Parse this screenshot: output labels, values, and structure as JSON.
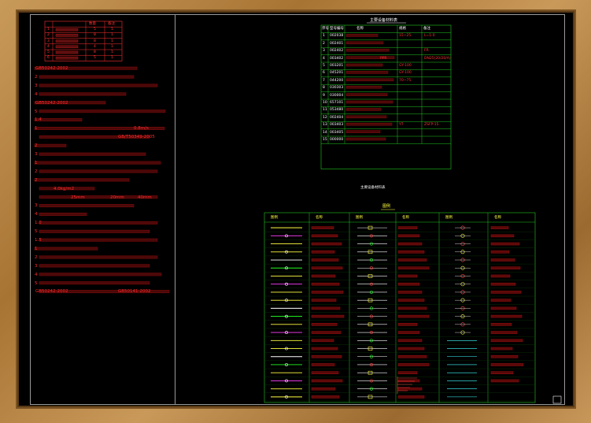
{
  "colors": {
    "frame": "#b5833f",
    "background": "#000000",
    "notes": "#ff2a2a",
    "table_border_left": "#ff3030",
    "table_border_right": "#20c820"
  },
  "notes_table": {
    "header": [
      "",
      "",
      "数量",
      "备注"
    ],
    "rows": [
      [
        "1",
        "",
        "5",
        "1"
      ],
      [
        "2",
        "",
        "8",
        "1"
      ],
      [
        "3",
        "",
        "8",
        "1"
      ],
      [
        "4",
        "",
        "4",
        "1"
      ],
      [
        "5",
        "",
        "8",
        "1"
      ],
      [
        "6",
        "",
        "5",
        "1"
      ]
    ]
  },
  "notes": [
    {
      "text": "GB50242-2002",
      "mixed": "说明：给排水管道安装符合国家规范",
      "row": 1
    },
    {
      "text": "2",
      "row": 2
    },
    {
      "text": "3",
      "row": 3
    },
    {
      "text": "4",
      "row": 4
    },
    {
      "text": "GB50242-2002",
      "row": 5
    },
    {
      "text": "5",
      "row": 6
    },
    {
      "text": "1.4",
      "row": 7
    },
    {
      "text": "1",
      "row": 8
    },
    {
      "text": "0.8m/s",
      "row": 8
    },
    {
      "text": "GB/T50349-2005",
      "row": 9
    },
    {
      "text": "2",
      "row": 10
    },
    {
      "text": "3",
      "row": 11
    },
    {
      "text": "1",
      "row": 12
    },
    {
      "text": "2",
      "row": 13
    },
    {
      "text": "2",
      "row": 14
    },
    {
      "text": "4.0kg/m2",
      "row": 15
    },
    {
      "text": "25mm",
      "row": 16
    },
    {
      "text": "20mm",
      "row": 16
    },
    {
      "text": "40mm",
      "row": 16
    },
    {
      "text": "3",
      "row": 17
    },
    {
      "text": "4",
      "row": 18
    },
    {
      "text": "1.0",
      "row": 19
    },
    {
      "text": "5",
      "row": 20
    },
    {
      "text": "1.5",
      "row": 21
    },
    {
      "text": "1",
      "row": 22
    },
    {
      "text": "2",
      "row": 23
    },
    {
      "text": "3",
      "row": 24
    },
    {
      "text": "4",
      "row": 25
    },
    {
      "text": "5",
      "row": 26
    },
    {
      "text": "GB50242-2002",
      "row": 27
    },
    {
      "text": "GB50141-2002",
      "row": 27
    }
  ],
  "materials_table": {
    "title": "主要设备材料表",
    "header": [
      "序号",
      "型号编号",
      "名称",
      "规格",
      "备注"
    ],
    "rows": [
      [
        "1",
        "002038",
        "",
        "15~25",
        "L=1.0"
      ],
      [
        "2",
        "002401",
        "",
        "",
        ""
      ],
      [
        "3",
        "002402",
        "",
        "",
        "FR"
      ],
      [
        "4",
        "003402",
        "PPR",
        "",
        "DN25(20/20/A)"
      ],
      [
        "5",
        "003201",
        "",
        "GY-100",
        ""
      ],
      [
        "6",
        "045201",
        "",
        "GY-100",
        ""
      ],
      [
        "7",
        "044200",
        "",
        "70~75",
        ""
      ],
      [
        "8",
        "030303",
        "",
        "",
        ""
      ],
      [
        "9",
        "030004",
        "",
        "",
        ""
      ],
      [
        "10",
        "657101",
        "",
        "",
        ""
      ],
      [
        "11",
        "053480",
        "",
        "",
        ""
      ],
      [
        "12",
        "002404",
        "",
        "",
        ""
      ],
      [
        "13",
        "003403",
        "",
        "Y7",
        "ZSFP-15"
      ],
      [
        "14",
        "003405",
        "",
        "",
        ""
      ],
      [
        "15",
        "000000",
        "",
        "",
        ""
      ]
    ],
    "footer": "主要设备材料表"
  },
  "legend_table": {
    "title": "图例",
    "header": [
      "图例",
      "名称",
      "图例",
      "名称",
      "图例",
      "名称"
    ],
    "col1": [
      "",
      "",
      "",
      "",
      "",
      "",
      "",
      "",
      "",
      "",
      "",
      "",
      "",
      "",
      "",
      "",
      "",
      "",
      "",
      "",
      "",
      ""
    ],
    "col3": [
      "",
      "",
      "",
      "",
      "",
      "",
      "",
      "",
      "",
      "",
      "",
      "",
      "",
      "",
      "",
      "",
      "",
      "",
      "",
      "",
      "",
      ""
    ],
    "col5": [
      "",
      "",
      "",
      "",
      "",
      "",
      "",
      "",
      "",
      "",
      "",
      "",
      "",
      "",
      "",
      "",
      "",
      "",
      "",
      "",
      "",
      ""
    ]
  }
}
